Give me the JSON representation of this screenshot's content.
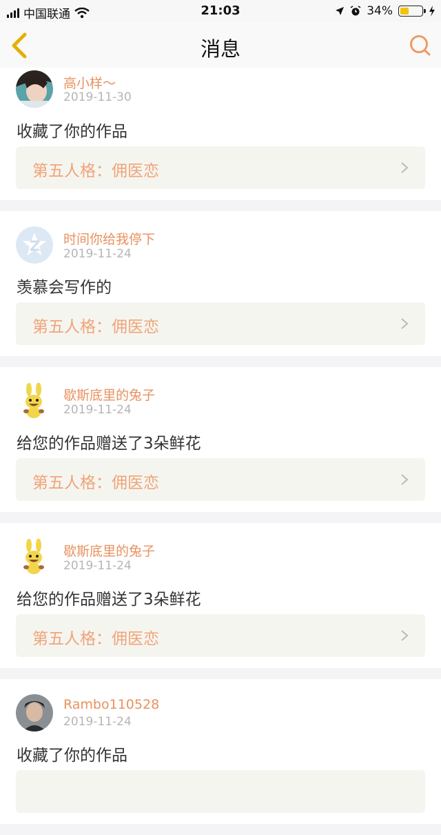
{
  "status_bar": {
    "carrier": "中国联通",
    "time": "21:03",
    "battery": "34%",
    "battery_level": 0.34
  },
  "header": {
    "title": "消息",
    "back_icon": "chevron-left-icon",
    "search_icon": "search-icon"
  },
  "colors": {
    "accent": "#e8915f",
    "link_text": "#f0a478",
    "link_bg": "#f5f5f0"
  },
  "messages": [
    {
      "user": "高小样～",
      "date": "2019-11-30",
      "action": "收藏了你的作品",
      "work": "第五人格：佣医恋"
    },
    {
      "user": "时间你给我停下",
      "date": "2019-11-24",
      "action": "羡慕会写作的",
      "work": "第五人格：佣医恋"
    },
    {
      "user": "歇斯底里的兔子",
      "date": "2019-11-24",
      "action": "给您的作品赠送了3朵鲜花",
      "work": "第五人格：佣医恋"
    },
    {
      "user": "歇斯底里的兔子",
      "date": "2019-11-24",
      "action": "给您的作品赠送了3朵鲜花",
      "work": "第五人格：佣医恋"
    },
    {
      "user": "Rambo110528",
      "date": "2019-11-24",
      "action": "收藏了你的作品",
      "work": ""
    }
  ]
}
